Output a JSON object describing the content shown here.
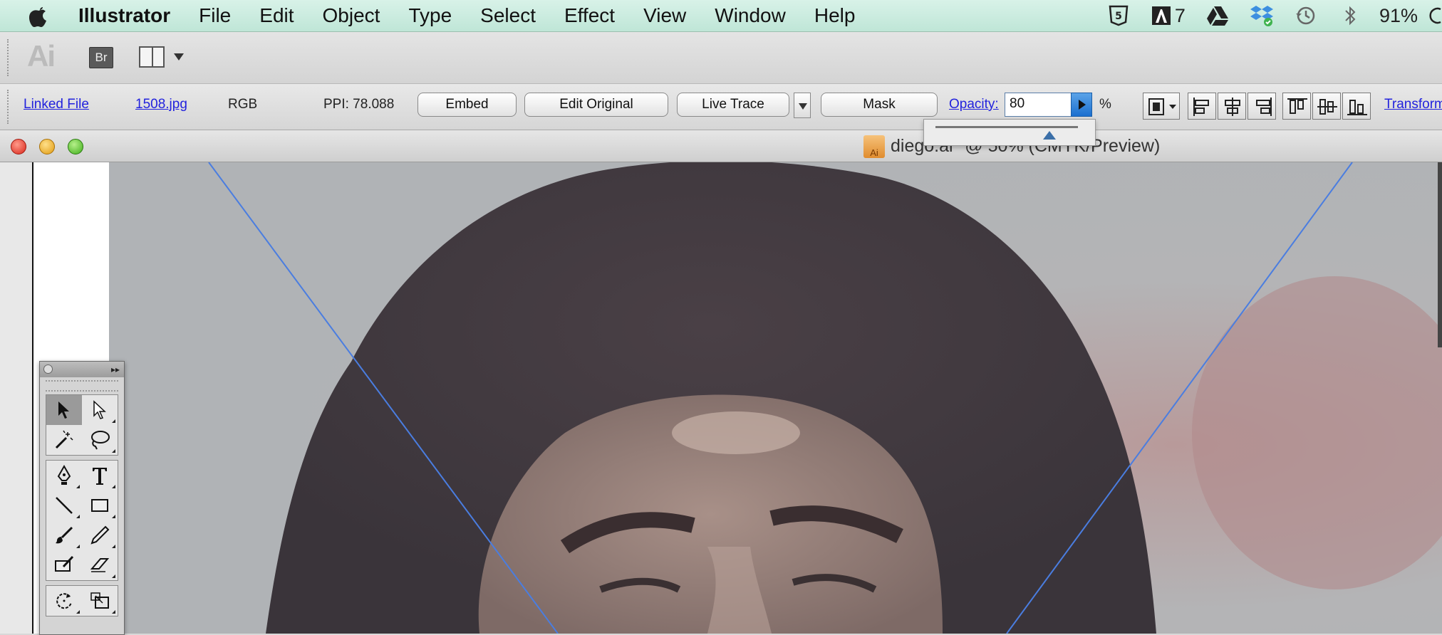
{
  "menubar": {
    "app_name": "Illustrator",
    "items": [
      "File",
      "Edit",
      "Object",
      "Type",
      "Select",
      "Effect",
      "View",
      "Window",
      "Help"
    ],
    "status": {
      "adobe_count": "7",
      "battery": "91%"
    }
  },
  "appbar": {
    "logo": "Ai",
    "bridge_label": "Br"
  },
  "control": {
    "linked_file": "Linked File",
    "file_name": "1508.jpg",
    "color_mode": "RGB",
    "ppi": "PPI: 78.088",
    "embed": "Embed",
    "edit_original": "Edit Original",
    "live_trace": "Live Trace",
    "mask": "Mask",
    "opacity_label": "Opacity:",
    "opacity_value": "80",
    "percent": "%",
    "transform": "Transform",
    "opacity_fraction": 0.8
  },
  "document": {
    "title": "diego.ai* @ 50% (CMYK/Preview)",
    "file_badge": "Ai"
  },
  "colors": {
    "menubar_accent": "#c8ecde",
    "link": "#2222dd",
    "guide_line": "#4a7de0",
    "opacity_button": "#1c6fcf"
  }
}
